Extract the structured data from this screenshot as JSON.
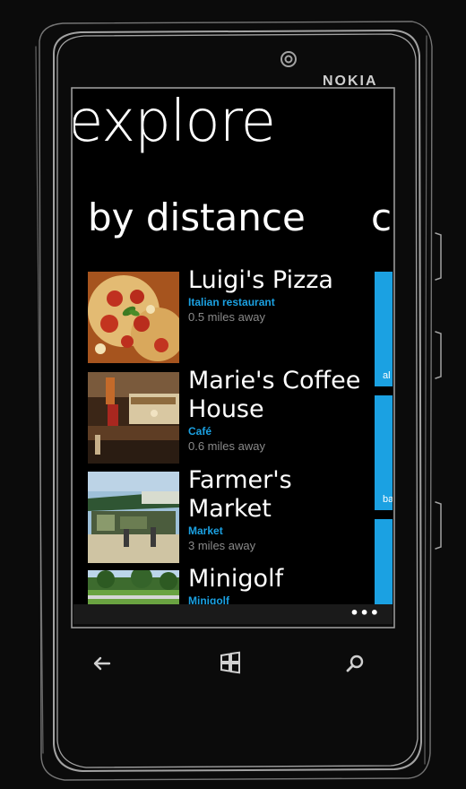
{
  "device": {
    "brand": "NOKIA"
  },
  "hub": {
    "title": "explore"
  },
  "pivot": {
    "current": "by distance",
    "next_peek": "c"
  },
  "places": [
    {
      "name": "Luigi's Pizza",
      "category": "Italian restaurant",
      "distance": "0.5 miles away",
      "thumb": "pizza"
    },
    {
      "name": "Marie's Coffee House",
      "category": "Café",
      "distance": "0.6 miles away",
      "thumb": "coffee"
    },
    {
      "name": "Farmer's Market",
      "category": "Market",
      "distance": "3 miles away",
      "thumb": "market"
    },
    {
      "name": "Minigolf",
      "category": "Minigolf",
      "distance": "",
      "thumb": "golf"
    }
  ],
  "side_tiles": [
    {
      "label": "al"
    },
    {
      "label": "ba"
    },
    {
      "label": ""
    }
  ],
  "app_bar": {
    "more": "•••"
  },
  "colors": {
    "accent": "#1ba1e2",
    "background": "#000000",
    "frame": "#0b0b0b"
  },
  "icons": {
    "back": "back-arrow-icon",
    "start": "windows-logo-icon",
    "search": "search-icon"
  }
}
